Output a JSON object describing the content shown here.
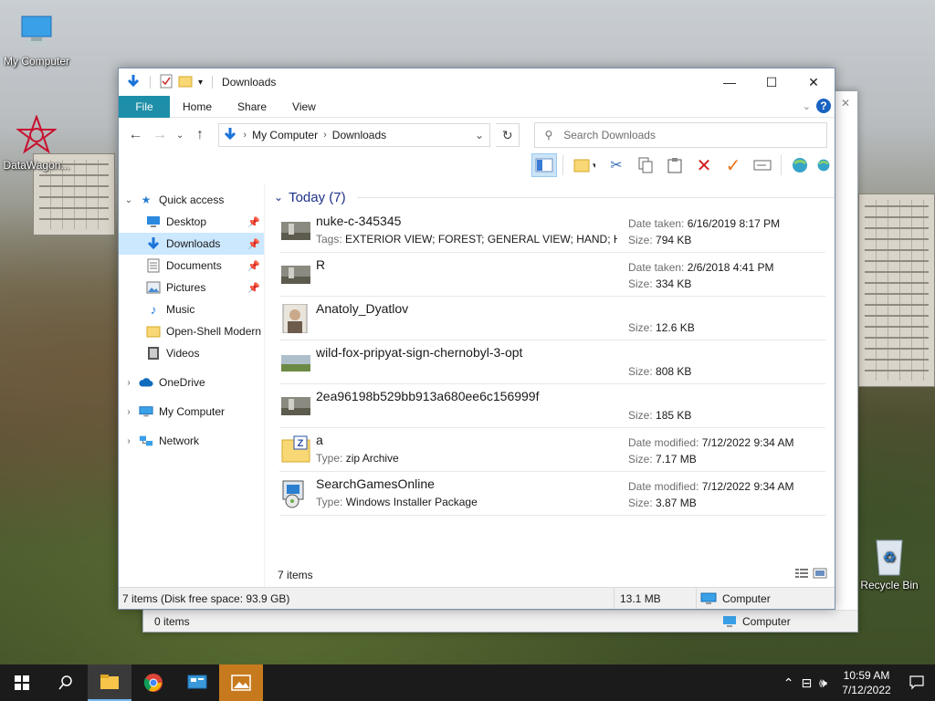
{
  "desktop": {
    "icons": [
      {
        "label": "My Computer"
      },
      {
        "label": "DataWagon..."
      },
      {
        "label": "Recycle Bin"
      }
    ]
  },
  "back_window": {
    "status_items": "0 items",
    "status_location": "Computer"
  },
  "window": {
    "title": "Downloads",
    "ribbon_tabs": [
      "File",
      "Home",
      "Share",
      "View"
    ],
    "address": {
      "crumbs": [
        "My Computer",
        "Downloads"
      ]
    },
    "search_placeholder": "Search Downloads",
    "nav": {
      "quick_access": "Quick access",
      "quick_items": [
        {
          "label": "Desktop",
          "icon": "desktop-icon",
          "pinned": true
        },
        {
          "label": "Downloads",
          "icon": "downloads-icon",
          "pinned": true,
          "selected": true
        },
        {
          "label": "Documents",
          "icon": "documents-icon",
          "pinned": true
        },
        {
          "label": "Pictures",
          "icon": "pictures-icon",
          "pinned": true
        },
        {
          "label": "Music",
          "icon": "music-icon",
          "pinned": false
        },
        {
          "label": "Open-Shell Modern",
          "icon": "folder-icon",
          "pinned": false
        },
        {
          "label": "Videos",
          "icon": "videos-icon",
          "pinned": false
        }
      ],
      "roots": [
        {
          "label": "OneDrive",
          "icon": "onedrive-icon"
        },
        {
          "label": "My Computer",
          "icon": "computer-icon"
        },
        {
          "label": "Network",
          "icon": "network-icon"
        }
      ]
    },
    "group_header": "Today (7)",
    "files": [
      {
        "name": "nuke-c-345345",
        "sub_key": "Tags:",
        "sub_val": "EXTERIOR VIEW; FOREST; GENERAL VIEW; HAND; HORI...",
        "r1_key": "Date taken:",
        "r1_val": "6/16/2019 8:17 PM",
        "r2_key": "Size:",
        "r2_val": "794 KB",
        "thumb": "photo"
      },
      {
        "name": "R",
        "sub_key": "",
        "sub_val": "",
        "r1_key": "Date taken:",
        "r1_val": "2/6/2018 4:41 PM",
        "r2_key": "Size:",
        "r2_val": "334 KB",
        "thumb": "photo"
      },
      {
        "name": "Anatoly_Dyatlov",
        "sub_key": "",
        "sub_val": "",
        "r1_key": "",
        "r1_val": "",
        "r2_key": "Size:",
        "r2_val": "12.6 KB",
        "thumb": "portrait"
      },
      {
        "name": "wild-fox-pripyat-sign-chernobyl-3-opt",
        "sub_key": "",
        "sub_val": "",
        "r1_key": "",
        "r1_val": "",
        "r2_key": "Size:",
        "r2_val": "808 KB",
        "thumb": "landscape"
      },
      {
        "name": "2ea96198b529bb913a680ee6c156999f",
        "sub_key": "",
        "sub_val": "",
        "r1_key": "",
        "r1_val": "",
        "r2_key": "Size:",
        "r2_val": "185 KB",
        "thumb": "photo"
      },
      {
        "name": "a",
        "sub_key": "Type:",
        "sub_val": "zip Archive",
        "r1_key": "Date modified:",
        "r1_val": "7/12/2022 9:34 AM",
        "r2_key": "Size:",
        "r2_val": "7.17 MB",
        "thumb": "zip"
      },
      {
        "name": "SearchGamesOnline",
        "sub_key": "Type:",
        "sub_val": "Windows Installer Package",
        "r1_key": "Date modified:",
        "r1_val": "7/12/2022 9:34 AM",
        "r2_key": "Size:",
        "r2_val": "3.87 MB",
        "thumb": "msi"
      }
    ],
    "items_count": "7 items",
    "status": {
      "left": "7 items (Disk free space: 93.9 GB)",
      "size": "13.1 MB",
      "location": "Computer"
    }
  },
  "taskbar": {
    "time": "10:59 AM",
    "date": "7/12/2022"
  }
}
